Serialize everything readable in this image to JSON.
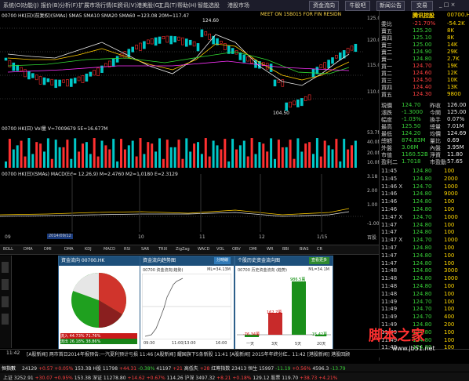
{
  "menu": {
    "items": [
      "系统(O)",
      "功能(J)",
      "报价(B)",
      "分析(F)",
      "扩展市场行情(E)",
      "资讯(V)",
      "港美股(G)",
      "工具(T)",
      "帮助(H)",
      "智能选股",
      "港股市场"
    ],
    "right_buttons": [
      "资金流向",
      "牛股吧",
      "新闻公告",
      "交易"
    ]
  },
  "kchart": {
    "header": "00700 HK(日)(前复权)(SMAs) SMA5 SMA10 SMA20 SMA60 =123.08 20M=117.47",
    "banner": "MEET ON 15B015   FOR FIN RESIDN",
    "high_label": "124.60",
    "low_label": "104.50",
    "yticks": [
      "125.00",
      "120.00",
      "115.00",
      "110.00"
    ]
  },
  "volume": {
    "header": "00700 HK(日) Vol量 V=7009679 5E=16.677M",
    "yticks": [
      "53.7M",
      "40.0M",
      "20.0M",
      "10.0M"
    ]
  },
  "macd": {
    "header": "00700 HK(日)(SMAs) MACD(Ed= 12,26,9) M=2.4760 M2=1.0180 E=2.3129",
    "yticks": [
      "3.18",
      "2.00",
      "1.00",
      "-1.00"
    ],
    "xlabels": [
      "09",
      "10",
      "11",
      "12",
      "1/15"
    ],
    "date_box": "2014/09/12",
    "unit": "百股"
  },
  "quote": {
    "stock_name": "腾讯控股",
    "code": "00700.HK",
    "rows": [
      {
        "l": "委比",
        "v": "-21.70%",
        "c": "-54.2K"
      },
      {
        "l": "賣五",
        "v": "125.20",
        "c": "8K"
      },
      {
        "l": "賣四",
        "v": "125.10",
        "c": "8K"
      },
      {
        "l": "賣三",
        "v": "125.00",
        "c": "14K"
      },
      {
        "l": "賣二",
        "v": "124.90",
        "c": "29K"
      },
      {
        "l": "賣一",
        "v": "124.80",
        "c": "2.7K"
      },
      {
        "l": "買一",
        "v": "124.70",
        "c": "19K"
      },
      {
        "l": "買二",
        "v": "124.60",
        "c": "12K"
      },
      {
        "l": "買三",
        "v": "124.50",
        "c": "10K"
      },
      {
        "l": "買四",
        "v": "124.40",
        "c": "13K"
      },
      {
        "l": "買五",
        "v": "124.30",
        "c": "9800"
      }
    ],
    "stats": [
      {
        "a": "現價",
        "b": "124.70",
        "c": "昨收",
        "d": "126.00"
      },
      {
        "a": "漲跌",
        "b": "-1.3000",
        "c": "今開",
        "d": "125.00"
      },
      {
        "a": "幅度",
        "b": "-1.03%",
        "c": "換手",
        "d": "0.07%"
      },
      {
        "a": "最高",
        "b": "125.50",
        "c": "總量",
        "d": "7.01M"
      },
      {
        "a": "最低",
        "b": "124.20",
        "c": "均價",
        "d": "124.69"
      },
      {
        "a": "總額",
        "b": "874.83M",
        "c": "量比",
        "d": "0.69"
      },
      {
        "a": "外盤",
        "b": "3.06M",
        "c": "內盤",
        "d": "3.95M"
      },
      {
        "a": "市值",
        "b": "1160.52B",
        "c": "淨資",
        "d": "11.80"
      },
      {
        "a": "盈利二",
        "b": "1.7018",
        "c": "市盈動",
        "d": "57.65"
      }
    ],
    "ticks": [
      {
        "t": "11:45",
        "p": "124.80",
        "v": "100"
      },
      {
        "t": "11:45",
        "p": "124.80",
        "v": "2000"
      },
      {
        "t": "11:46 X",
        "p": "124.70",
        "v": "1000"
      },
      {
        "t": "11:46",
        "p": "124.80",
        "v": "9000"
      },
      {
        "t": "11:46",
        "p": "124.80",
        "v": "100"
      },
      {
        "t": "11:46",
        "p": "124.80",
        "v": "100"
      },
      {
        "t": "11:47 X",
        "p": "124.70",
        "v": "1000"
      },
      {
        "t": "11:47",
        "p": "124.80",
        "v": "100"
      },
      {
        "t": "11:47",
        "p": "124.80",
        "v": "100"
      },
      {
        "t": "11:47 X",
        "p": "124.70",
        "v": "1000"
      },
      {
        "t": "11:47",
        "p": "124.80",
        "v": "100"
      },
      {
        "t": "11:47",
        "p": "124.80",
        "v": "100"
      },
      {
        "t": "11:47",
        "p": "124.80",
        "v": "100"
      },
      {
        "t": "11:48",
        "p": "124.80",
        "v": "3000"
      },
      {
        "t": "11:48",
        "p": "124.80",
        "v": "1000"
      },
      {
        "t": "11:48",
        "p": "124.80",
        "v": "100"
      },
      {
        "t": "11:48",
        "p": "124.80",
        "v": "100"
      },
      {
        "t": "11:49",
        "p": "124.70",
        "v": "100"
      },
      {
        "t": "11:49",
        "p": "124.70",
        "v": "100"
      },
      {
        "t": "11:49",
        "p": "124.70",
        "v": "400"
      },
      {
        "t": "11:49",
        "p": "124.80",
        "v": "200"
      },
      {
        "t": "11:49",
        "p": "124.80",
        "v": "100"
      },
      {
        "t": "11:49",
        "p": "124.80",
        "v": "100"
      },
      {
        "t": "11:49",
        "p": "124.80",
        "v": "100"
      }
    ]
  },
  "toolbar2": [
    "BOLL",
    "DMA",
    "DMI",
    "DMA",
    "KDJ",
    "MACD",
    "RSI",
    "SAR",
    "TRIX",
    "ZigZag",
    "WACD",
    "VOL",
    "OBV",
    "DMI",
    "WR",
    "BBI",
    "BIAS",
    "CR"
  ],
  "panel1": {
    "title": "資金流向 00700.HK",
    "rows": [
      {
        "a": "流入",
        "b": "44.73%",
        "c": "71.76%"
      },
      {
        "a": "流出",
        "b": "26.18%",
        "c": "38.86%"
      },
      {
        "a": "",
        "b": "主力",
        "c": "散户"
      }
    ]
  },
  "panel2": {
    "title": "資金流向趋势图",
    "button": "分時線",
    "sub": "00700 资金流向(趋勢)",
    "value": "ML=34.13M",
    "times": [
      "09:30",
      "11:00/13:00",
      "16:00"
    ]
  },
  "panel3": {
    "title": "个股历史资金流向图",
    "button": "查看更多",
    "sub": "00700 历史资金流向 (趋势)",
    "value": "ML=34.1M",
    "bars": [
      {
        "label": "一天",
        "value": "-76.34萬"
      },
      {
        "label": "3天",
        "value": "162.7萬"
      },
      {
        "label": "5天",
        "value": "986.5萬"
      },
      {
        "label": "20天",
        "value": "-15.42萬"
      }
    ]
  },
  "ticker": {
    "time": "11:42",
    "text": "[A股新闻] 两市首日2014年报预告:一汽夏利预计亏损 11:46 [A股新闻] 耀国旗下5条新股 11:41 [A股新闻] 2015年年终分红.. 11:42 [港股新闻] 港股回顾"
  },
  "status1": {
    "prefix": "恒指數",
    "items": [
      "24129",
      "+0.57",
      "+0.05%",
      "153.3B",
      "H股",
      "11798",
      "+44.31",
      "-0.38%",
      "41197",
      "+21",
      "高低失",
      "+28",
      "红筹指数",
      "23413",
      "恒生",
      "15997",
      "-11.19",
      "+0.56%",
      "4596.3",
      "-13.79"
    ]
  },
  "status2": {
    "items": [
      "上证",
      "3252.91",
      "+30.07",
      "+0.95%",
      "153.3B",
      "深证",
      "11278.80",
      "+14.62",
      "+0.67%",
      "114.26",
      "沪深",
      "3497.32",
      "+8.21",
      "+0.18%",
      "129.12",
      "股票",
      "119.70",
      "+38.73",
      "+4.21%"
    ]
  },
  "watermark": {
    "big": "脚本之家",
    "small": "www.jb51.net"
  }
}
